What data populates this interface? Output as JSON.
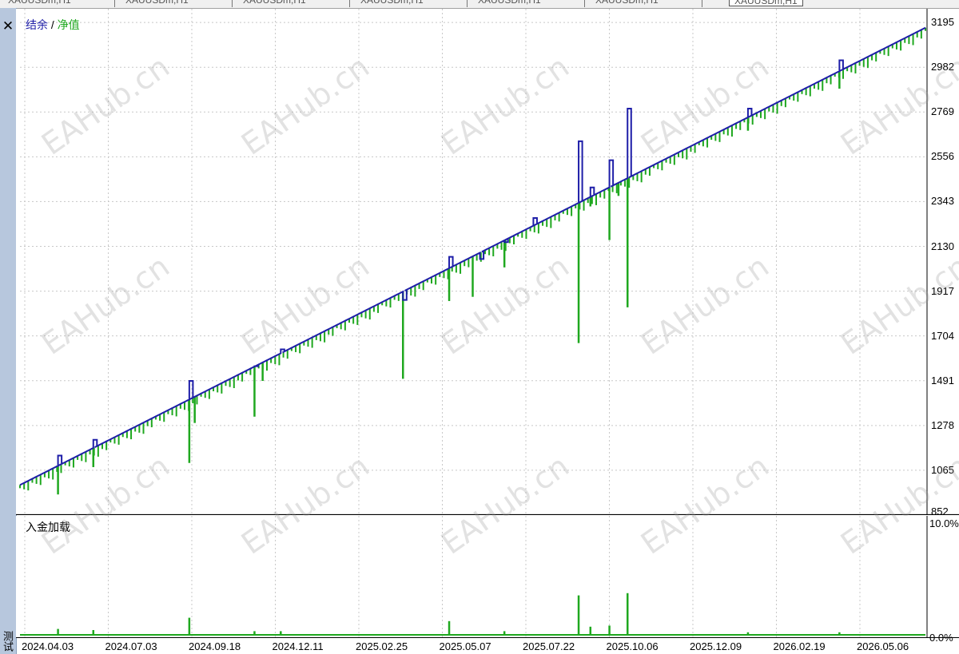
{
  "tabs": [
    {
      "label": "XAUUSDm,H1",
      "selected": false
    },
    {
      "label": "XAUUSDm,H1",
      "selected": false
    },
    {
      "label": "XAUUSDm,H1",
      "selected": false
    },
    {
      "label": "XAUUSDm,H1",
      "selected": false
    },
    {
      "label": "XAUUSDm,H1",
      "selected": false
    },
    {
      "label": "XAUUSDm,H1",
      "selected": false
    },
    {
      "label": "XAUUSDm,H1",
      "selected": true
    }
  ],
  "close_glyph": "✕",
  "side_label": "测试",
  "watermark_text": "EAHub.cn",
  "colors": {
    "balance": "#1e1ea8",
    "equity": "#1fa81f",
    "grid": "#c8c8c8",
    "axis": "#000000"
  },
  "chart_data": [
    {
      "type": "line",
      "legend": {
        "balance_label": "结余",
        "separator": "/",
        "equity_label": "净值"
      },
      "y_ticks": [
        "3195",
        "2982",
        "2769",
        "2556",
        "2343",
        "2130",
        "1917",
        "1704",
        "1491",
        "1278",
        "1065",
        "852"
      ],
      "ylim": [
        852,
        3260
      ],
      "x_ticks": [
        "2024.04.03",
        "2024.07.03",
        "2024.09.18",
        "2024.12.11",
        "2025.02.25",
        "2025.05.07",
        "2025.07.22",
        "2025.10.06",
        "2025.12.09",
        "2026.02.19",
        "2026.05.06"
      ],
      "balance_series": {
        "name": "结余",
        "start": 995,
        "end": 3170
      },
      "balance_spikes": [
        {
          "t": 0.042,
          "value": 1135
        },
        {
          "t": 0.081,
          "value": 1210
        },
        {
          "t": 0.187,
          "value": 1490
        },
        {
          "t": 0.259,
          "value": 1560
        },
        {
          "t": 0.288,
          "value": 1640
        },
        {
          "t": 0.423,
          "value": 1875
        },
        {
          "t": 0.474,
          "value": 2080
        },
        {
          "t": 0.508,
          "value": 2070
        },
        {
          "t": 0.535,
          "value": 2150
        },
        {
          "t": 0.567,
          "value": 2265
        },
        {
          "t": 0.617,
          "value": 2630
        },
        {
          "t": 0.63,
          "value": 2410
        },
        {
          "t": 0.651,
          "value": 2540
        },
        {
          "t": 0.671,
          "value": 2785
        },
        {
          "t": 0.804,
          "value": 2785
        },
        {
          "t": 0.905,
          "value": 3015
        }
      ],
      "equity_drawdowns": [
        {
          "t": 0.042,
          "value": 950
        },
        {
          "t": 0.081,
          "value": 1080
        },
        {
          "t": 0.187,
          "value": 1100
        },
        {
          "t": 0.193,
          "value": 1290
        },
        {
          "t": 0.259,
          "value": 1320
        },
        {
          "t": 0.268,
          "value": 1490
        },
        {
          "t": 0.423,
          "value": 1500
        },
        {
          "t": 0.474,
          "value": 1870
        },
        {
          "t": 0.5,
          "value": 1890
        },
        {
          "t": 0.535,
          "value": 2030
        },
        {
          "t": 0.617,
          "value": 1670
        },
        {
          "t": 0.63,
          "value": 2320
        },
        {
          "t": 0.651,
          "value": 2160
        },
        {
          "t": 0.661,
          "value": 2370
        },
        {
          "t": 0.671,
          "value": 1840
        },
        {
          "t": 0.804,
          "value": 2680
        },
        {
          "t": 0.905,
          "value": 2880
        }
      ]
    },
    {
      "type": "bar",
      "title": "入金加载",
      "y_ticks": [
        "10.0%",
        "0.0%"
      ],
      "ylim": [
        0,
        10
      ],
      "spikes": [
        {
          "t": 0.042,
          "value": 0.6
        },
        {
          "t": 0.081,
          "value": 0.5
        },
        {
          "t": 0.187,
          "value": 1.6
        },
        {
          "t": 0.259,
          "value": 0.4
        },
        {
          "t": 0.288,
          "value": 0.4
        },
        {
          "t": 0.474,
          "value": 1.3
        },
        {
          "t": 0.535,
          "value": 0.4
        },
        {
          "t": 0.617,
          "value": 3.6
        },
        {
          "t": 0.63,
          "value": 0.8
        },
        {
          "t": 0.651,
          "value": 0.9
        },
        {
          "t": 0.671,
          "value": 3.8
        },
        {
          "t": 0.804,
          "value": 0.3
        },
        {
          "t": 0.905,
          "value": 0.3
        }
      ]
    }
  ]
}
